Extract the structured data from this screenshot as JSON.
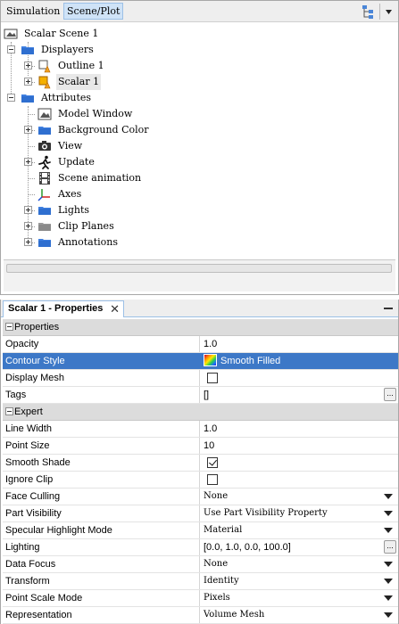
{
  "top_tabs": {
    "simulation": "Simulation",
    "scene_plot": "Scene/Plot"
  },
  "tree": {
    "root": "Scalar Scene 1",
    "displayers": "Displayers",
    "outline": "Outline 1",
    "scalar": "Scalar 1",
    "attributes": "Attributes",
    "model_window": "Model Window",
    "background_color": "Background Color",
    "view": "View",
    "update": "Update",
    "scene_animation": "Scene animation",
    "axes": "Axes",
    "lights": "Lights",
    "clip_planes": "Clip Planes",
    "annotations": "Annotations"
  },
  "properties_panel": {
    "tab_title": "Scalar 1 - Properties",
    "close_glyph": "✕",
    "sections": {
      "properties": "Properties",
      "expert": "Expert"
    },
    "rows": {
      "opacity": {
        "name": "Opacity",
        "value": "1.0"
      },
      "contour_style": {
        "name": "Contour Style",
        "value": "Smooth Filled"
      },
      "display_mesh": {
        "name": "Display Mesh",
        "checked": false
      },
      "tags": {
        "name": "Tags",
        "value": "[]"
      },
      "line_width": {
        "name": "Line Width",
        "value": "1.0"
      },
      "point_size": {
        "name": "Point Size",
        "value": "10"
      },
      "smooth_shade": {
        "name": "Smooth Shade",
        "checked": true
      },
      "ignore_clip": {
        "name": "Ignore Clip",
        "checked": false
      },
      "face_culling": {
        "name": "Face Culling",
        "value": "None"
      },
      "part_visibility": {
        "name": "Part Visibility",
        "value": "Use Part Visibility Property"
      },
      "specular_highlight_mode": {
        "name": "Specular Highlight Mode",
        "value": "Material"
      },
      "lighting": {
        "name": "Lighting",
        "value": "[0.0, 1.0, 0.0, 100.0]"
      },
      "data_focus": {
        "name": "Data Focus",
        "value": "None"
      },
      "transform": {
        "name": "Transform",
        "value": "Identity"
      },
      "point_scale_mode": {
        "name": "Point Scale Mode",
        "value": "Pixels"
      },
      "representation": {
        "name": "Representation",
        "value": "Volume Mesh"
      }
    },
    "ellipsis": "..."
  },
  "colors": {
    "selection": "#3d78c7",
    "tab_highlight": "#cfe3f7",
    "folder": "#3f7fe0",
    "section_bg": "#dcdcdc"
  }
}
